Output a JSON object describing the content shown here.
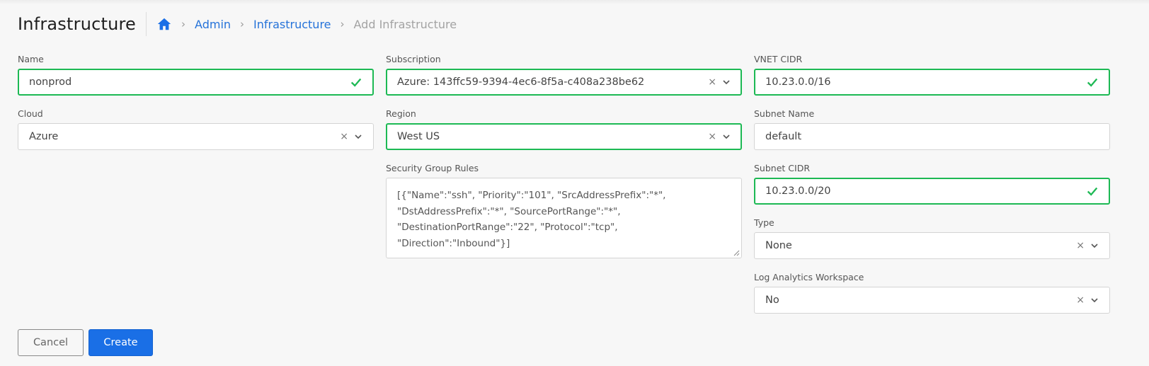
{
  "header": {
    "title": "Infrastructure",
    "breadcrumb": [
      "Admin",
      "Infrastructure"
    ],
    "breadcrumb_current": "Add Infrastructure"
  },
  "colors": {
    "accent": "#1a6fe6",
    "link": "#2673d9",
    "valid": "#1db954"
  },
  "form": {
    "name": {
      "label": "Name",
      "value": "nonprod"
    },
    "cloud": {
      "label": "Cloud",
      "value": "Azure"
    },
    "subscription": {
      "label": "Subscription",
      "value": "Azure: 143ffc59-9394-4ec6-8f5a-c408a238be62"
    },
    "region": {
      "label": "Region",
      "value": "West US"
    },
    "security_group_rules": {
      "label": "Security Group Rules",
      "lines": [
        "[{\"Name\":\"ssh\", \"Priority\":\"101\", \"SrcAddressPrefix\":\"*\",",
        "\"DstAddressPrefix\":\"*\", \"SourcePortRange\":\"*\",",
        "\"DestinationPortRange\":\"22\", \"Protocol\":\"tcp\",",
        "\"Direction\":\"Inbound\"}]"
      ]
    },
    "vnet_cidr": {
      "label": "VNET CIDR",
      "value": "10.23.0.0/16"
    },
    "subnet_name": {
      "label": "Subnet Name",
      "value": "default"
    },
    "subnet_cidr": {
      "label": "Subnet CIDR",
      "value": "10.23.0.0/20"
    },
    "type": {
      "label": "Type",
      "value": "None"
    },
    "log_analytics": {
      "label": "Log Analytics Workspace",
      "value": "No"
    }
  },
  "icons": {
    "home": "home-icon",
    "valid": "check-icon",
    "clear": "clear-icon",
    "dropdown": "chevron-down-icon"
  },
  "actions": {
    "cancel": "Cancel",
    "create": "Create"
  }
}
